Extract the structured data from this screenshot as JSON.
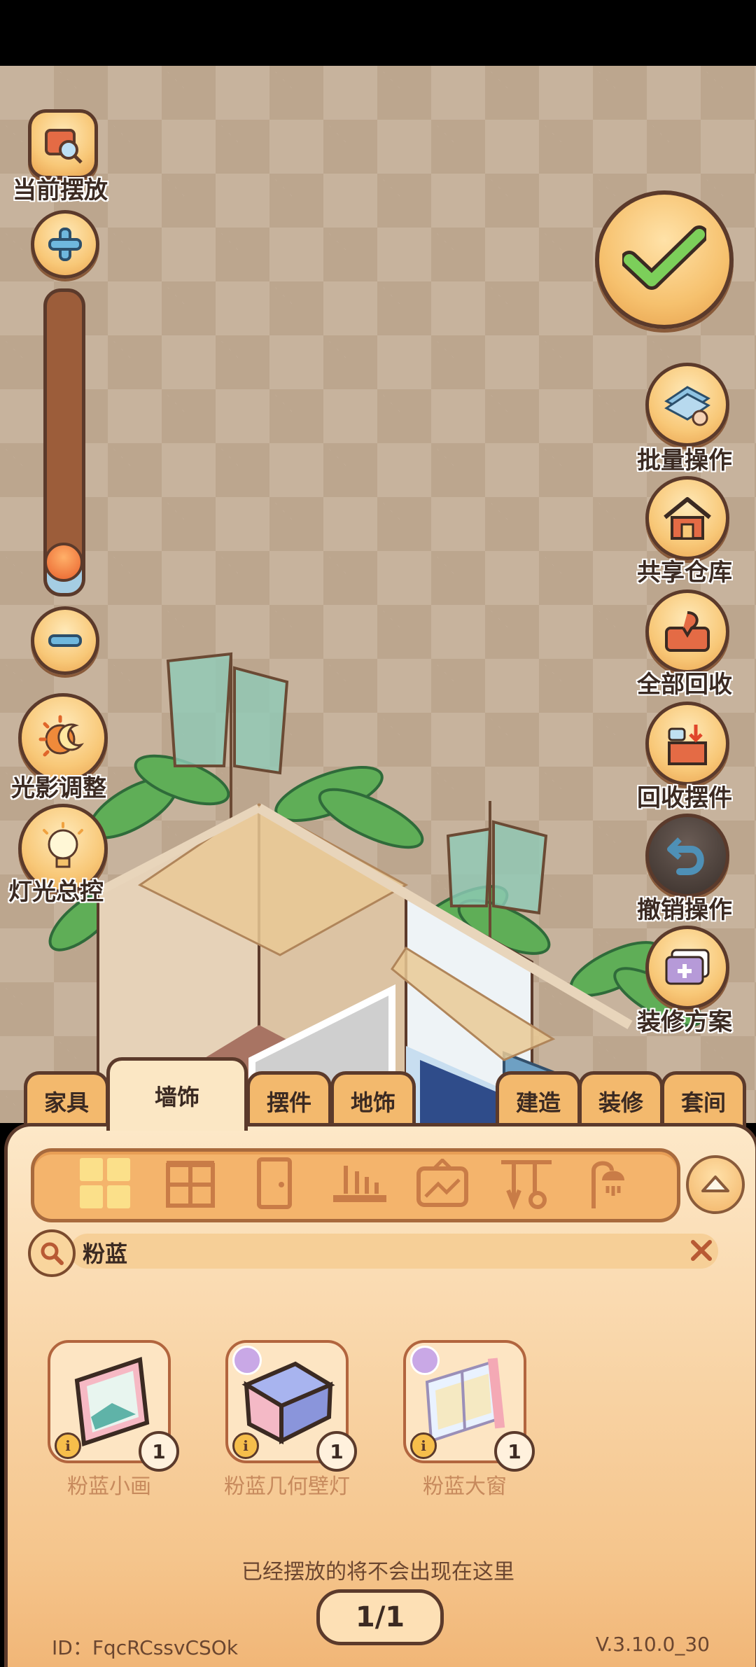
{
  "left_controls": {
    "current_placement": "当前摆放",
    "light_shadow": "光影调整",
    "light_master": "灯光总控",
    "zoom_level": 0.1
  },
  "right_controls": {
    "batch": "批量操作",
    "shared_storage": "共享仓库",
    "recycle_all": "全部回收",
    "recycle_items": "回收摆件",
    "undo": "撤销操作",
    "decoration_plan": "装修方案"
  },
  "tabs": [
    {
      "label": "家具"
    },
    {
      "label": "墙饰"
    },
    {
      "label": "摆件"
    },
    {
      "label": "地饰"
    },
    {
      "label": "建造"
    },
    {
      "label": "装修"
    },
    {
      "label": "套间"
    }
  ],
  "search": {
    "value": "粉蓝"
  },
  "items": [
    {
      "name": "粉蓝小画",
      "qty": "1"
    },
    {
      "name": "粉蓝几何壁灯",
      "qty": "1"
    },
    {
      "name": "粉蓝大窗",
      "qty": "1"
    }
  ],
  "hint": "已经摆放的将不会出现在这里",
  "page": "1/1",
  "footer": {
    "id": "ID：FqcRCssvCSOk",
    "version": "V.3.10.0_30"
  },
  "colors": {
    "accent": "#f3b96d",
    "outline": "#5b3a2b"
  }
}
